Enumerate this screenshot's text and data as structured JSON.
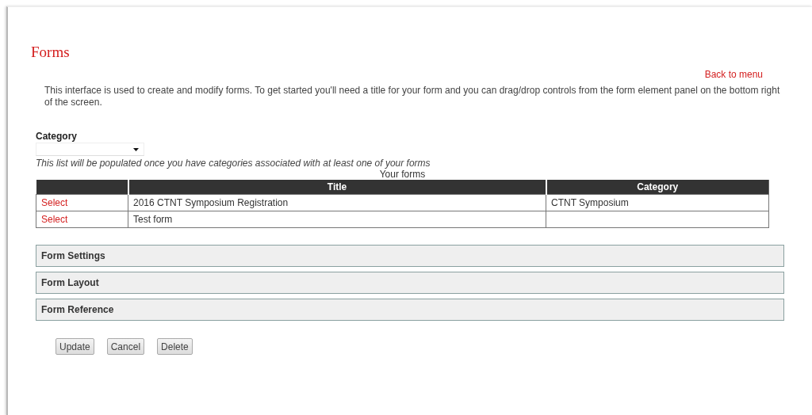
{
  "page": {
    "title": "Forms",
    "back_link": "Back to menu",
    "intro": "This interface is used to create and modify forms. To get started you'll need a title for your form and you can drag/drop controls from the form element panel on the bottom right of the screen."
  },
  "category": {
    "label": "Category",
    "note": "This list will be populated once you have categories associated with at least one of your forms"
  },
  "table": {
    "caption": "Your forms",
    "columns": [
      "Title",
      "Category"
    ],
    "rows": [
      {
        "action": "Select",
        "title": "2016 CTNT Symposium Registration",
        "category": "CTNT Symposium"
      },
      {
        "action": "Select",
        "title": "Test form"
      }
    ]
  },
  "panels": [
    {
      "label": "Form Settings",
      "expanded": false
    },
    {
      "label": "Form Layout",
      "expanded": false
    },
    {
      "label": "Form Reference",
      "expanded": false
    }
  ],
  "buttons": [
    "Update",
    "Cancel",
    "Delete"
  ]
}
